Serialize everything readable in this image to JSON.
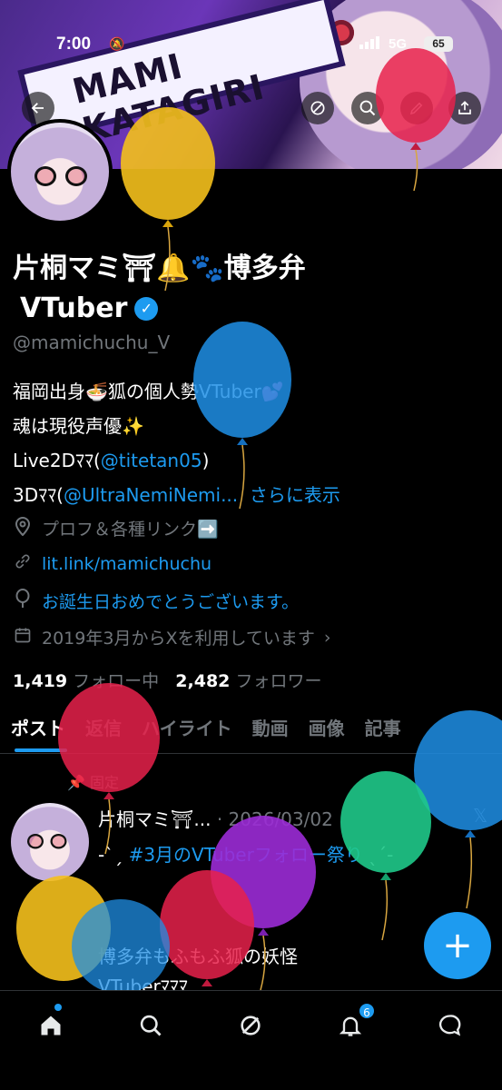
{
  "status_bar": {
    "time": "7:00",
    "network": "5G",
    "battery": "65"
  },
  "banner": {
    "text": "MAMI KATAGIRI"
  },
  "profile": {
    "name_line1": "片桐マミ⛩🔔🐾博多弁",
    "name_line2": "VTuber",
    "handle": "@mamichuchu_V",
    "bio": {
      "line1": "福岡出身🍜狐の個人勢VTuber💕",
      "line2": "魂は現役声優✨",
      "line3_prefix": "Live2Dﾏﾏ(",
      "line3_link": "@titetan05",
      "line3_suffix": ")",
      "line4_prefix": "3Dﾏﾏ(",
      "line4_link": "@UltraNemiNemi...",
      "more": "さらに表示"
    },
    "location": "プロフ＆各種リンク➡️",
    "website": "lit.link/mamichuchu",
    "birthday": "お誕生日おめでとうございます。",
    "joined": "2019年3月からXを利用しています",
    "following_count": "1,419",
    "following_label": "フォロー中",
    "followers_count": "2,482",
    "followers_label": "フォロワー"
  },
  "tabs": [
    "ポスト",
    "返信",
    "ハイライト",
    "動画",
    "画像",
    "記事"
  ],
  "post": {
    "pinned_label": "固定",
    "author": "片桐マミ⛩...",
    "date": "· 2026/03/02",
    "line1_prefix": "-ˋˏ ",
    "line1_hashtag": "#3月のVTuberフォロー祭り",
    "line1_suffix": " ˎˊ-",
    "line2": "博多弁もふもふ狐の妖怪",
    "line3": "VTuberﾏﾏﾏ..."
  },
  "bottom_nav": {
    "notification_count": "6"
  },
  "colors": {
    "accent": "#1d9bf0",
    "background": "#000000",
    "muted": "#71767b"
  },
  "icons": [
    "back-icon",
    "grok-icon",
    "search-icon",
    "edit-icon",
    "share-icon",
    "location-icon",
    "link-icon",
    "balloon-icon",
    "calendar-icon",
    "home-icon",
    "explore-icon",
    "grok-nav-icon",
    "notifications-icon",
    "messages-icon",
    "plus-icon"
  ]
}
